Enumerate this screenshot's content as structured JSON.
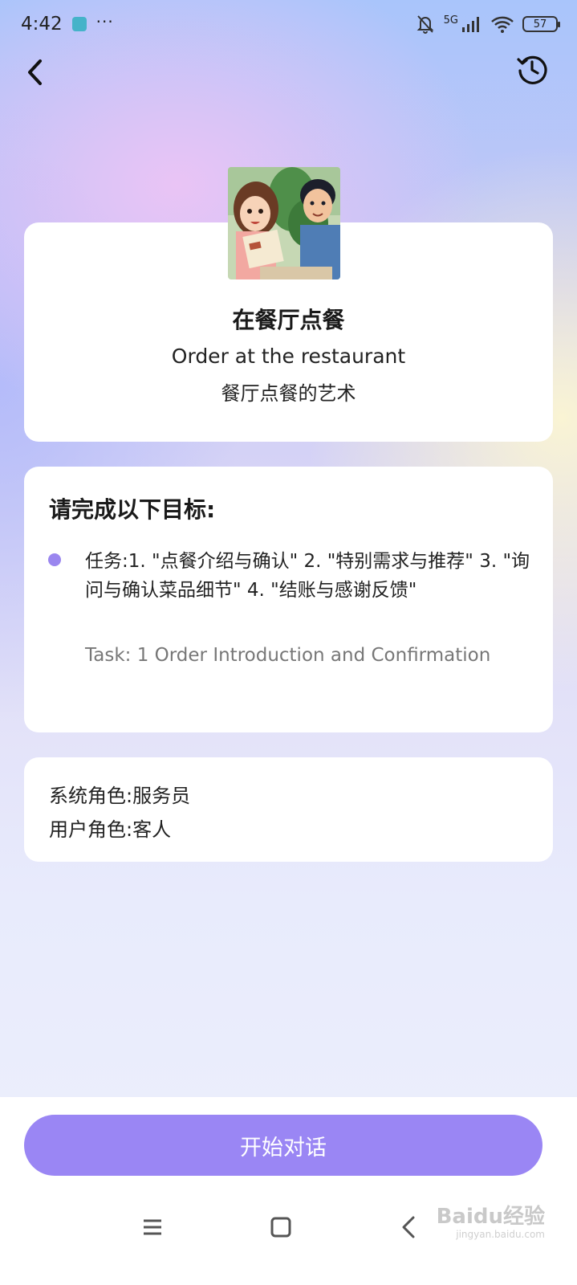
{
  "status_bar": {
    "time": "4:42",
    "more": "···",
    "network": "5G",
    "battery": "57",
    "icons": [
      "app-icon",
      "mute-icon",
      "signal-icon",
      "wifi-icon",
      "battery-icon"
    ]
  },
  "nav": {
    "back_icon": "chevron-left-icon",
    "history_icon": "history-icon"
  },
  "scene": {
    "title_cn": "在餐厅点餐",
    "title_en": "Order at the restaurant",
    "subtitle": "餐厅点餐的艺术"
  },
  "goals": {
    "heading": "请完成以下目标:",
    "task_cn": "任务:1. \"点餐介绍与确认\" 2. \"特别需求与推荐\" 3. \"询问与确认菜品细节\" 4. \"结账与感谢反馈\"",
    "task_en": "Task: 1 Order Introduction and Confirmation"
  },
  "roles": {
    "system": "系统角色:服务员",
    "user": "用户角色:客人"
  },
  "actions": {
    "start_label": "开始对话"
  },
  "watermark": {
    "brand": "Baidu经验",
    "url": "jingyan.baidu.com"
  },
  "colors": {
    "accent": "#9a86f4",
    "bullet": "#9a86ef",
    "card": "#ffffff"
  }
}
